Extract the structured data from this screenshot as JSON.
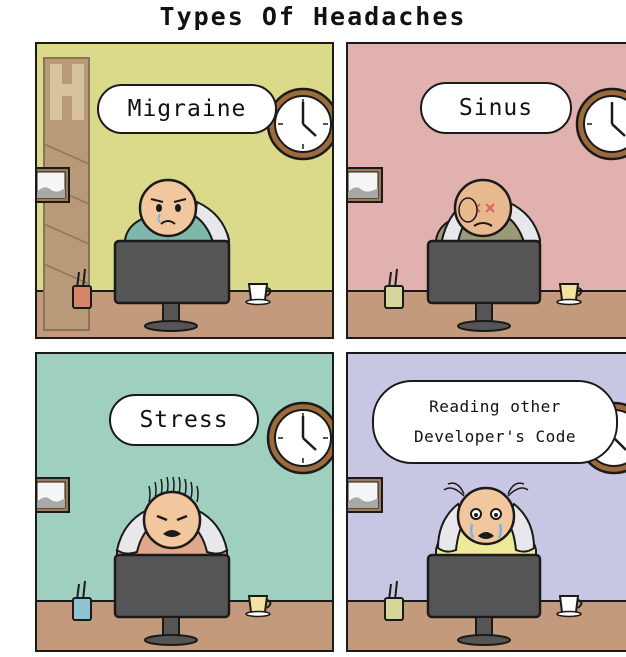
{
  "title": "Types Of Headaches",
  "colors": {
    "outline": "#1a1a1a",
    "floor": "#c49a7c",
    "skin": "#f2c79e",
    "monitor": "#555555"
  },
  "panels": [
    {
      "id": "migraine",
      "label": "Migraine",
      "wall_color": "#dbd98a",
      "shirt_color": "#7fb8a8",
      "expression": "sad",
      "icons": [
        "hook-icon",
        "clock-icon",
        "picture-frame-icon",
        "monitor-icon",
        "pencil-cup-icon",
        "coffee-mug-icon"
      ]
    },
    {
      "id": "sinus",
      "label": "Sinus",
      "wall_color": "#e0b1ae",
      "shirt_color": "#9a9a78",
      "expression": "pain",
      "icons": [
        "clock-icon",
        "picture-frame-icon",
        "monitor-icon",
        "pencil-cup-icon",
        "coffee-mug-icon"
      ]
    },
    {
      "id": "stress",
      "label": "Stress",
      "wall_color": "#9fcfbe",
      "shirt_color": "#e0a88c",
      "expression": "stressed",
      "icons": [
        "clock-icon",
        "picture-frame-icon",
        "monitor-icon",
        "pencil-cup-icon",
        "coffee-mug-icon"
      ]
    },
    {
      "id": "code",
      "label": "Reading other\nDeveloper's  Code",
      "wall_color": "#c7c7e4",
      "shirt_color": "#efe99c",
      "expression": "crying",
      "icons": [
        "clock-icon",
        "picture-frame-icon",
        "monitor-icon",
        "pencil-cup-icon",
        "coffee-mug-icon"
      ]
    }
  ]
}
